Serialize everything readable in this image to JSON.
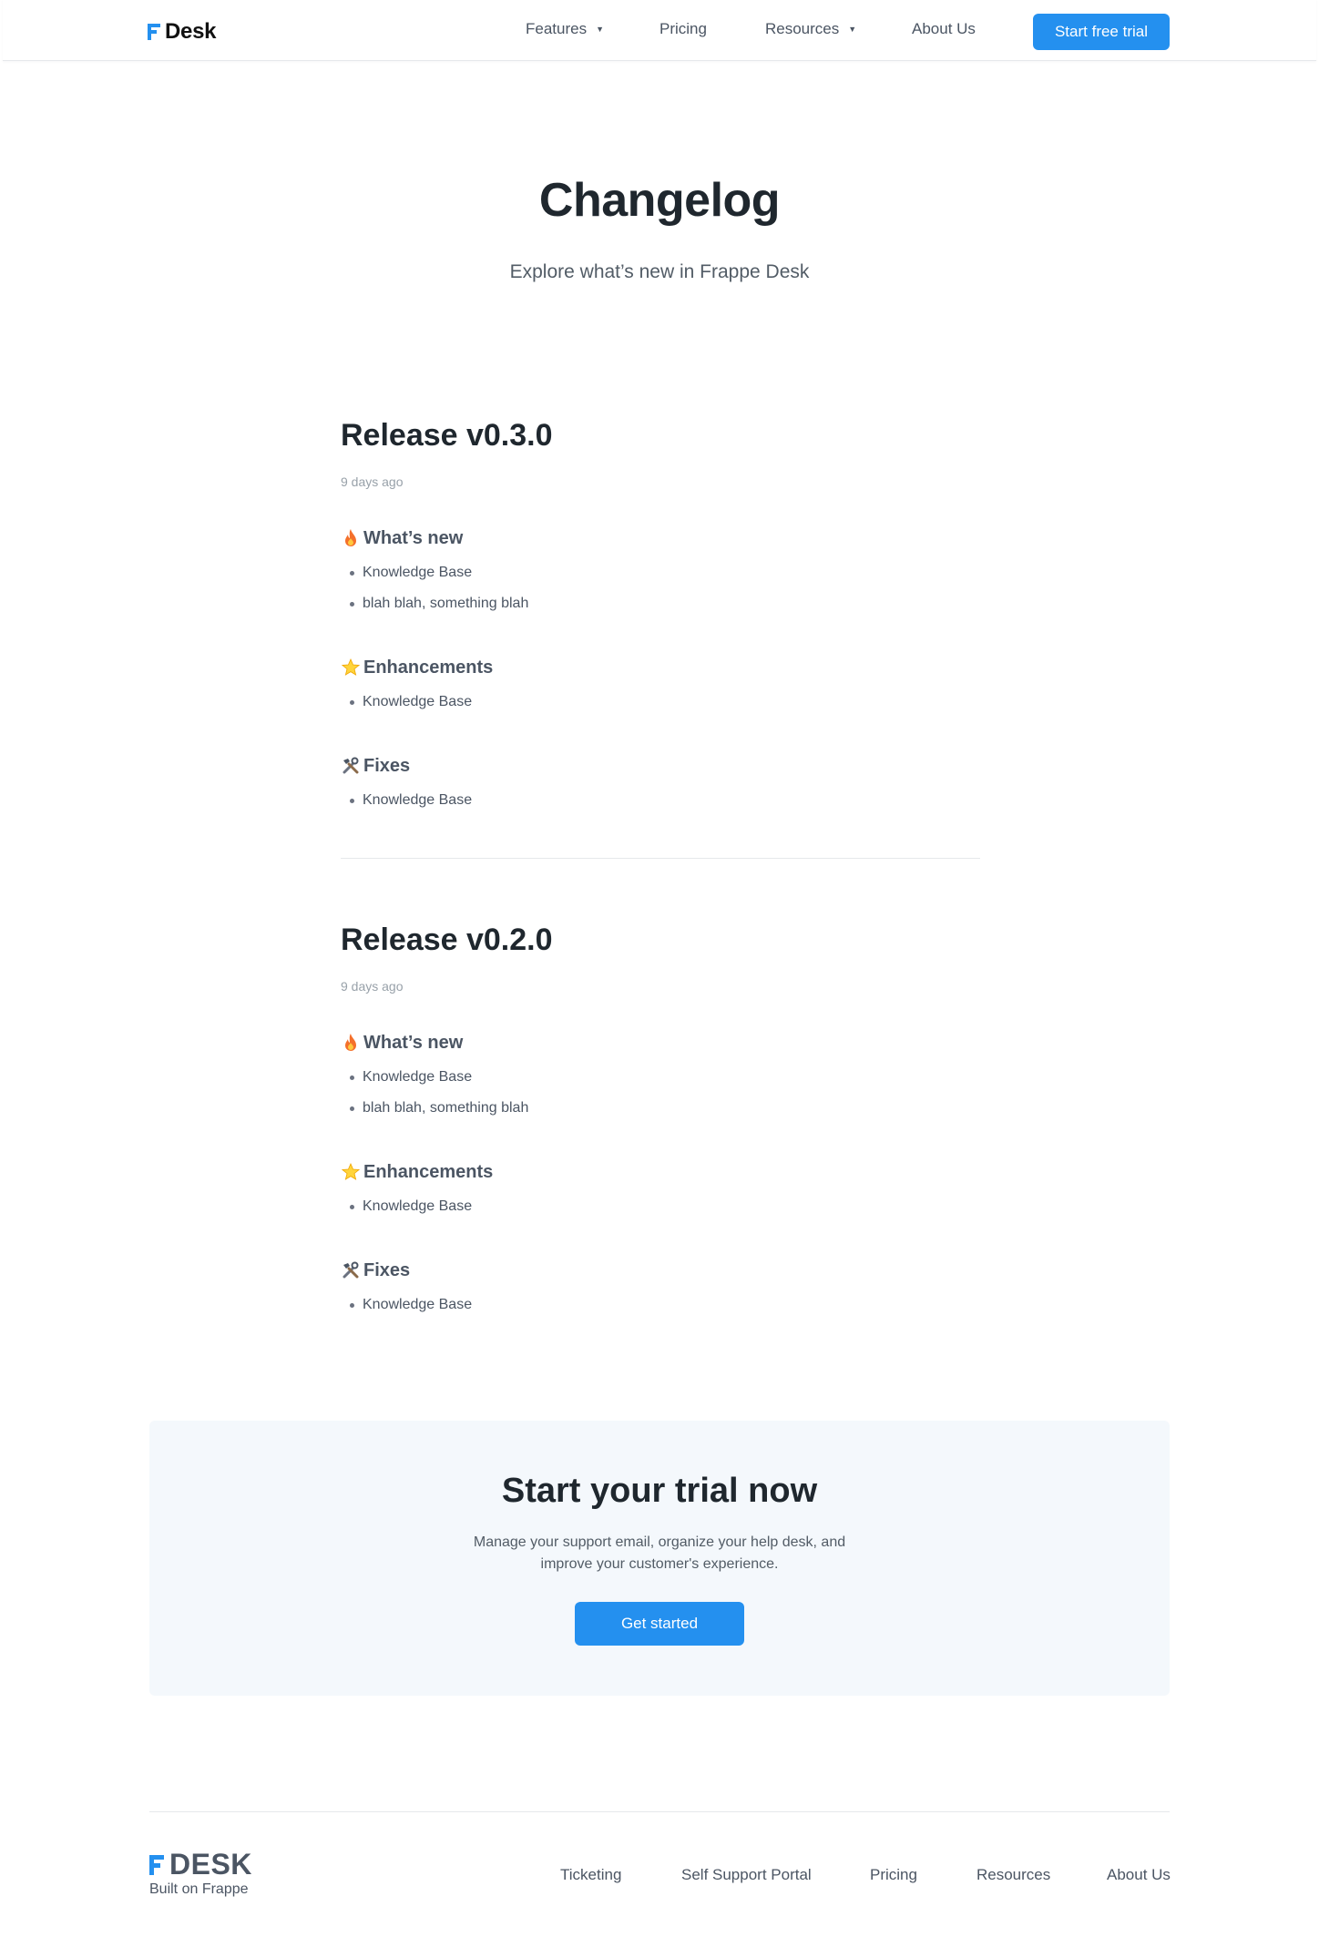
{
  "header": {
    "logo_text": "Desk",
    "nav": {
      "features": "Features",
      "pricing": "Pricing",
      "resources": "Resources",
      "about": "About Us"
    },
    "cta": "Start free trial"
  },
  "hero": {
    "title": "Changelog",
    "subtitle": "Explore what’s new in Frappe Desk"
  },
  "releases": [
    {
      "title": "Release v0.3.0",
      "date": "9 days ago",
      "sections": [
        {
          "icon": "fire-icon",
          "title": "What’s new",
          "items": [
            "Knowledge Base",
            "blah blah, something blah"
          ]
        },
        {
          "icon": "star-icon",
          "title": "Enhancements",
          "items": [
            "Knowledge Base"
          ]
        },
        {
          "icon": "tools-icon",
          "title": "Fixes",
          "items": [
            "Knowledge Base"
          ]
        }
      ]
    },
    {
      "title": "Release v0.2.0",
      "date": "9 days ago",
      "sections": [
        {
          "icon": "fire-icon",
          "title": "What’s new",
          "items": [
            "Knowledge Base",
            "blah blah, something blah"
          ]
        },
        {
          "icon": "star-icon",
          "title": "Enhancements",
          "items": [
            "Knowledge Base"
          ]
        },
        {
          "icon": "tools-icon",
          "title": "Fixes",
          "items": [
            "Knowledge Base"
          ]
        }
      ]
    }
  ],
  "trial": {
    "title": "Start your trial now",
    "description": "Manage your support email, organize your help desk, and improve your customer's experience.",
    "button": "Get started"
  },
  "footer": {
    "logo_text": "DESK",
    "tagline": "Built on Frappe",
    "links": {
      "ticketing": "Ticketing",
      "portal": "Self Support Portal",
      "pricing": "Pricing",
      "resources": "Resources",
      "about": "About Us"
    }
  },
  "colors": {
    "accent": "#2490ef",
    "heading": "#1f272e",
    "body_text": "#4b5563",
    "muted": "#98a1a9",
    "trial_bg": "#f4f8fc"
  }
}
